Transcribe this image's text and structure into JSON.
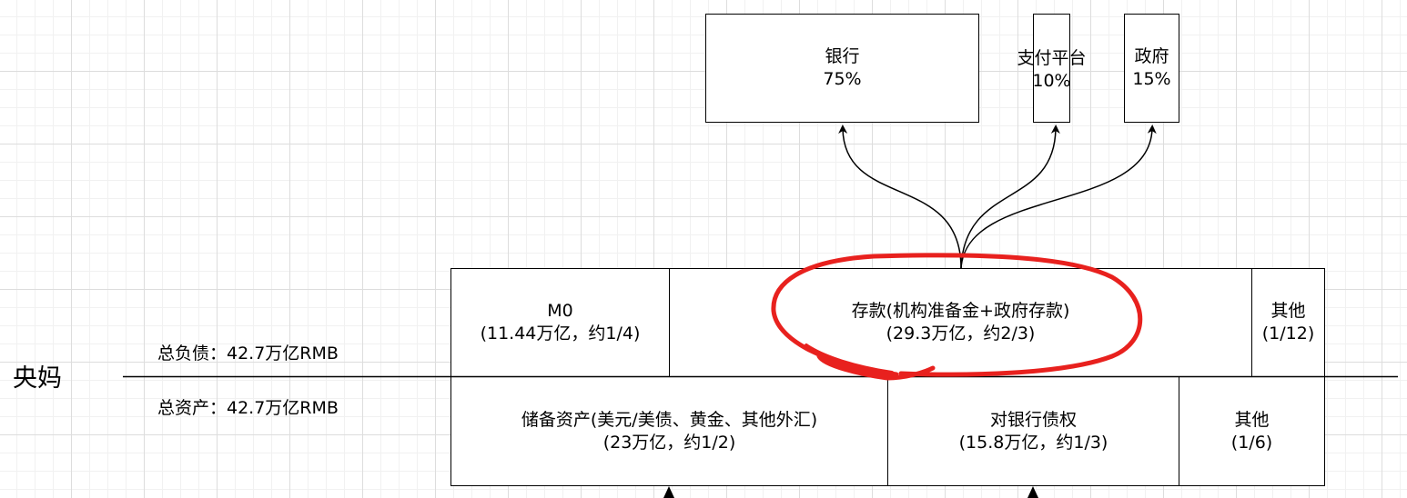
{
  "central_bank": {
    "name": "央妈",
    "total_liabilities": "总负债：42.7万亿RMB",
    "total_assets": "总资产：42.7万亿RMB"
  },
  "liabilities": {
    "m0": {
      "line1": "M0",
      "line2": "(11.44万亿，约1/4)"
    },
    "deposits": {
      "line1": "存款(机构准备金+政府存款)",
      "line2": "(29.3万亿，约2/3)"
    },
    "other": {
      "line1": "其他",
      "line2": "(1/12)"
    }
  },
  "assets": {
    "reserves": {
      "line1": "储备资产(美元/美债、黄金、其他外汇)",
      "line2": "(23万亿，约1/2)"
    },
    "bank_claims": {
      "line1": "对银行债权",
      "line2": "(15.8万亿，约1/3)"
    },
    "other": {
      "line1": "其他",
      "line2": "(1/6)"
    }
  },
  "deposit_holders": {
    "banks": {
      "line1": "银行",
      "line2": "75%"
    },
    "payment_platforms": {
      "line1": "支付平台",
      "line2": "10%"
    },
    "government": {
      "line1": "政府",
      "line2": "15%"
    }
  },
  "colors": {
    "highlight": "#e8211e",
    "stroke": "#000000",
    "grid_major": "#dddddd",
    "grid_minor": "#f1f1f1"
  }
}
